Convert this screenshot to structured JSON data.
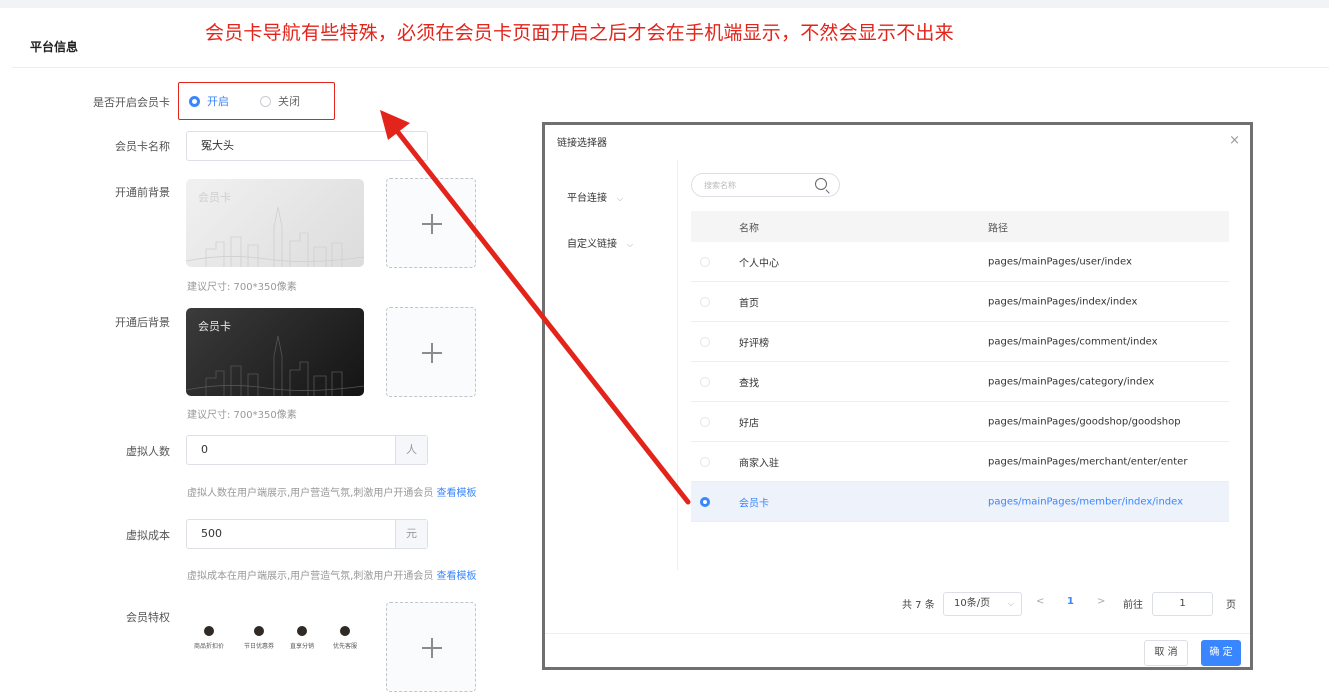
{
  "annotation": "会员卡导航有些特殊，必须在会员卡页面开启之后才会在手机端显示，不然会显示不出来",
  "section_title": "平台信息",
  "form": {
    "enable_label": "是否开启会员卡",
    "enable_on": "开启",
    "enable_off": "关闭",
    "name_label": "会员卡名称",
    "name_value": "冤大头",
    "bg_before_label": "开通前背景",
    "bg_after_label": "开通后背景",
    "card_title": "会员卡",
    "size_hint": "建议尺寸: 700*350像素",
    "virtual_people_label": "虚拟人数",
    "virtual_people_value": "0",
    "virtual_people_unit": "人",
    "virtual_people_hint": "虚拟人数在用户端展示,用户营造气氛,刺激用户开通会员",
    "virtual_cost_label": "虚拟成本",
    "virtual_cost_value": "500",
    "virtual_cost_unit": "元",
    "virtual_cost_hint": "虚拟成本在用户端展示,用户营造气氛,刺激用户开通会员",
    "view_template": "查看模板",
    "privilege_label": "会员特权",
    "privileges": [
      "商品折扣价",
      "节日优惠券",
      "直享分销",
      "优先客服"
    ]
  },
  "modal": {
    "title": "链接选择器",
    "close": "×",
    "side": [
      "平台连接",
      "自定义链接"
    ],
    "search_placeholder": "搜索名称",
    "col_name": "名称",
    "col_path": "路径",
    "rows": [
      {
        "name": "个人中心",
        "path": "pages/mainPages/user/index"
      },
      {
        "name": "首页",
        "path": "pages/mainPages/index/index"
      },
      {
        "name": "好评榜",
        "path": "pages/mainPages/comment/index"
      },
      {
        "name": "查找",
        "path": "pages/mainPages/category/index"
      },
      {
        "name": "好店",
        "path": "pages/mainPages/goodshop/goodshop"
      },
      {
        "name": "商家入驻",
        "path": "pages/mainPages/merchant/enter/enter"
      },
      {
        "name": "会员卡",
        "path": "pages/mainPages/member/index/index"
      }
    ],
    "total": "共 7 条",
    "page_size": "10条/页",
    "page_current": "1",
    "goto_label": "前往",
    "goto_value": "1",
    "page_unit": "页",
    "cancel": "取 消",
    "confirm": "确 定"
  },
  "colors": {
    "accent": "#3a86ff",
    "annotation": "#e3241b"
  }
}
